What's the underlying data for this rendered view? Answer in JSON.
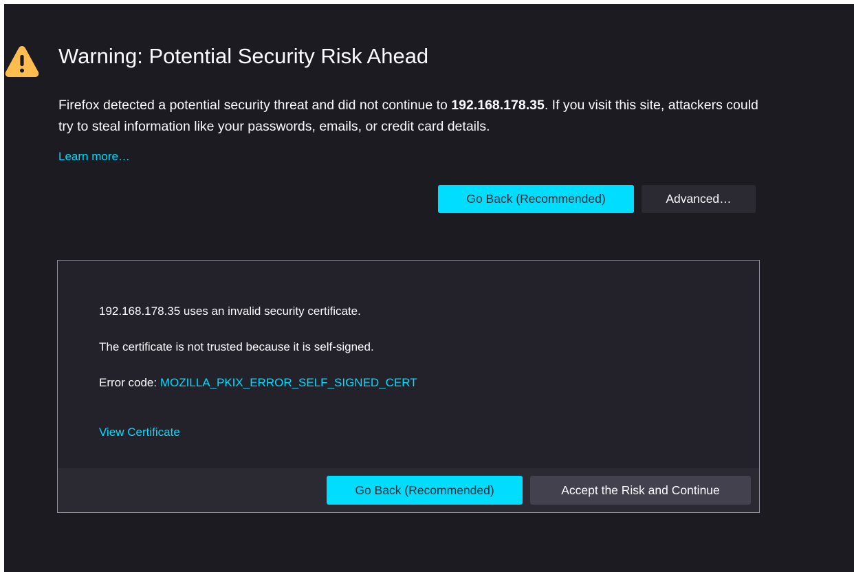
{
  "page": {
    "title": "Warning: Potential Security Risk Ahead",
    "intro_before": "Firefox detected a potential security threat and did not continue to ",
    "intro_host": "192.168.178.35",
    "intro_after": ". If you visit this site, attackers could try to steal information like your passwords, emails, or credit card details.",
    "learn_more": "Learn more…",
    "go_back_label": "Go Back (Recommended)",
    "advanced_label": "Advanced…"
  },
  "advanced_panel": {
    "invalid_cert_text": "192.168.178.35 uses an invalid security certificate.",
    "not_trusted_text": "The certificate is not trusted because it is self-signed.",
    "error_code_label": "Error code: ",
    "error_code": "MOZILLA_PKIX_ERROR_SELF_SIGNED_CERT",
    "view_certificate": "View Certificate",
    "go_back_label": "Go Back (Recommended)",
    "accept_label": "Accept the Risk and Continue"
  },
  "icons": {
    "warning": "warning-triangle-icon"
  },
  "colors": {
    "background": "#1c1b22",
    "panel": "#23222b",
    "accent": "#00ddff",
    "warning": "#ffbd4f",
    "text": "#fbfbfe"
  }
}
